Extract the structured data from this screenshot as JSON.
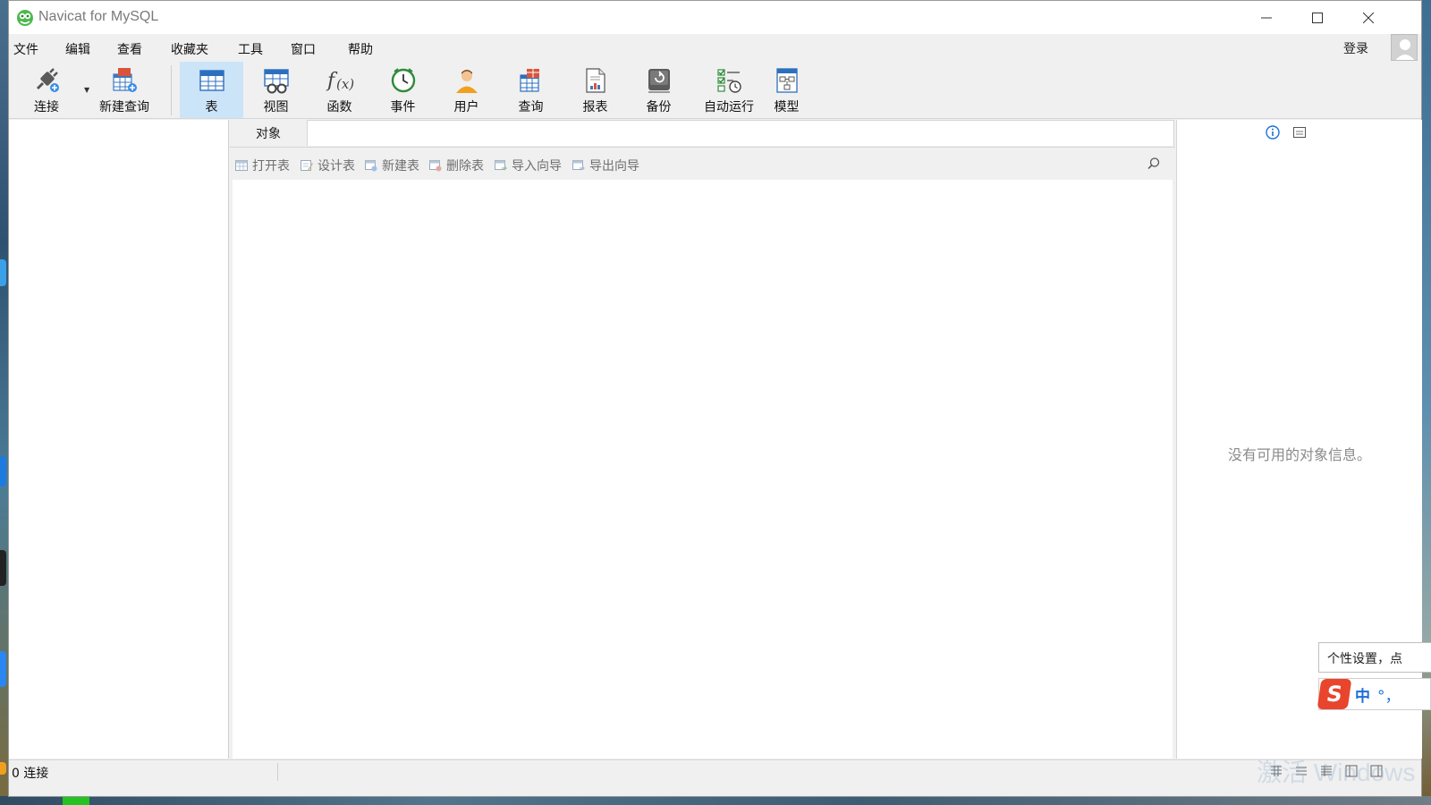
{
  "window": {
    "title": "Navicat for MySQL",
    "controls": {
      "minimize": "minimize",
      "maximize": "maximize",
      "close": "close"
    }
  },
  "menu": {
    "items": [
      "文件",
      "编辑",
      "查看",
      "收藏夹",
      "工具",
      "窗口",
      "帮助"
    ],
    "login": "登录"
  },
  "toolbar": {
    "items": [
      {
        "label": "连接",
        "icon": "plug-connect-icon"
      },
      {
        "label": "新建查询",
        "icon": "new-query-icon"
      },
      {
        "label": "表",
        "icon": "table-icon",
        "active": true
      },
      {
        "label": "视图",
        "icon": "view-icon"
      },
      {
        "label": "函数",
        "icon": "function-icon"
      },
      {
        "label": "事件",
        "icon": "clock-event-icon"
      },
      {
        "label": "用户",
        "icon": "user-icon"
      },
      {
        "label": "查询",
        "icon": "query-icon"
      },
      {
        "label": "报表",
        "icon": "report-icon"
      },
      {
        "label": "备份",
        "icon": "backup-icon"
      },
      {
        "label": "自动运行",
        "icon": "auto-run-icon"
      },
      {
        "label": "模型",
        "icon": "model-icon"
      }
    ]
  },
  "object_tab": {
    "label": "对象"
  },
  "object_toolbar": {
    "buttons": [
      "打开表",
      "设计表",
      "新建表",
      "删除表",
      "导入向导",
      "导出向导"
    ]
  },
  "info_pane": {
    "empty_message": "没有可用的对象信息。"
  },
  "status": {
    "connections": "0 连接"
  },
  "ime": {
    "tooltip": "个性设置，点",
    "mode": "中",
    "punct": "°，"
  },
  "watermark": "激活 Windows",
  "colors": {
    "active_tab": "#cce4f7",
    "accent": "#1e6fd9",
    "ime_logo": "#e8452c"
  }
}
